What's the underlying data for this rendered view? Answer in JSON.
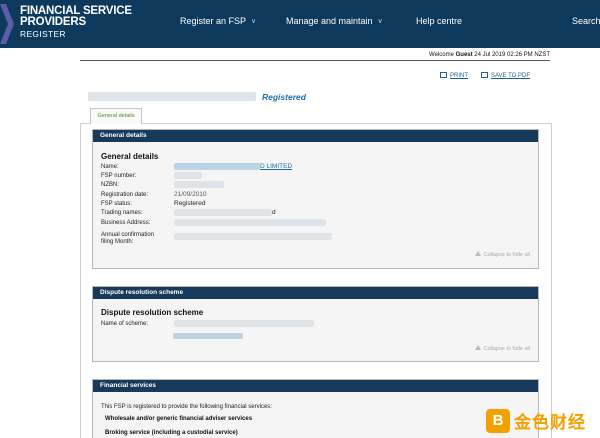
{
  "header": {
    "brand_line1": "FINANCIAL SERVICE",
    "brand_line2": "PROVIDERS",
    "brand_line3": "REGISTER",
    "nav": [
      {
        "label": "Register an FSP",
        "has_menu": true
      },
      {
        "label": "Manage and maintain",
        "has_menu": true
      },
      {
        "label": "Help centre",
        "has_menu": false
      },
      {
        "label": "Search",
        "has_menu": false
      }
    ],
    "colors": {
      "bar": "#0d3a5c",
      "chevron": "#5a5ea8"
    }
  },
  "welcome": {
    "prefix": "Welcome ",
    "user": "Guest",
    "datetime": " 24 Jul 2019 02:26 PM NZST"
  },
  "tools": {
    "print_label": "PRINT",
    "save_label": "SAVE TO PDF"
  },
  "company": {
    "name_suffix": "Registered"
  },
  "tab": {
    "label": "General details"
  },
  "general_details": {
    "header": "General details",
    "title": "General details",
    "fields": [
      {
        "label": "Name:",
        "value": "D LIMITED"
      },
      {
        "label": "FSP number:",
        "value": ""
      },
      {
        "label": "NZBN:",
        "value": ""
      },
      {
        "label": "Registration date:",
        "value": "21/09/2010"
      },
      {
        "label": "FSP status:",
        "value": "Registered"
      },
      {
        "label": "Trading names:",
        "value": "d"
      },
      {
        "label": "Business Address:",
        "value": ""
      },
      {
        "label": "Annual confirmation",
        "value": ""
      },
      {
        "label": "filing Month:",
        "value": ""
      }
    ],
    "collapse": "Collapse to hide all"
  },
  "dispute": {
    "header": "Dispute resolution scheme",
    "title": "Dispute resolution scheme",
    "name_label": "Name of scheme:",
    "collapse": "Collapse to hide all"
  },
  "financial_services": {
    "header": "Financial services",
    "intro": "This FSP is registered to provide the following financial services:",
    "items": [
      "Wholesale and/or generic financial adviser services",
      "Broking service (including a custodial service)"
    ]
  },
  "watermark": {
    "logo": "B",
    "text": "金色财经"
  }
}
